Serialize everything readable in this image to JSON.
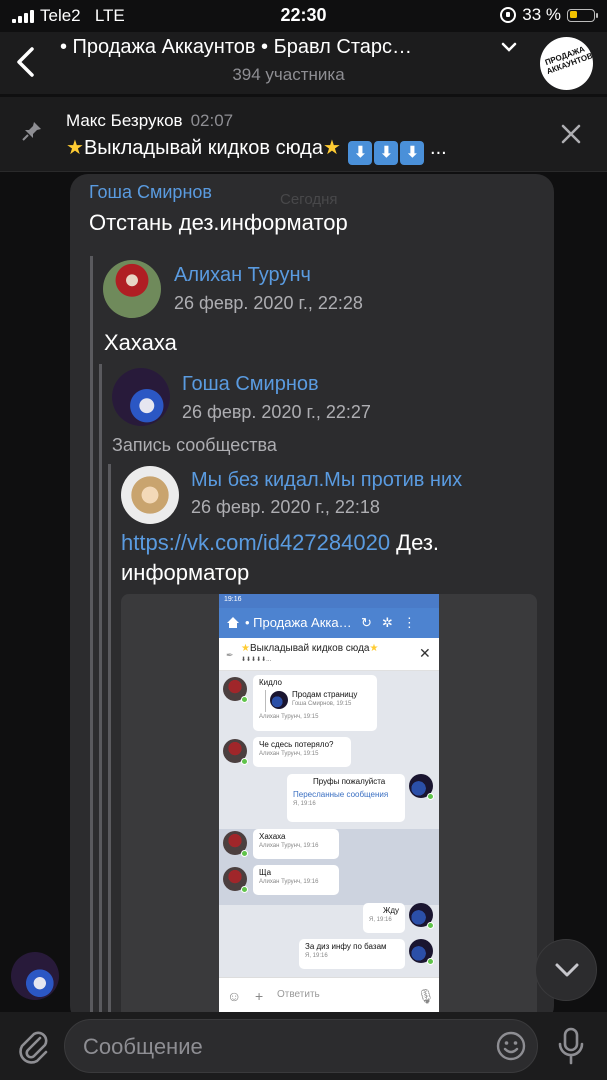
{
  "status_bar": {
    "carrier": "Tele2",
    "network": "LTE",
    "time": "22:30",
    "battery": "33 %",
    "battery_level": 0.33
  },
  "header": {
    "title": "• Продажа Аккаунтов • Бравл Старс…",
    "subtitle": "394 участника",
    "back_icon": "chevron-left-icon",
    "avatar_text": "ПРОДАЖА АККАУНТОВ"
  },
  "pinned": {
    "author": "Макс Безруков",
    "time": "02:07",
    "text": "Выкладывай кидков сюда",
    "trail": "...",
    "pin_icon": "pin-icon",
    "close_icon": "close-icon"
  },
  "message": {
    "author": "Гоша Смирнов",
    "date_badge": "Сегодня",
    "text": "Отстань дез.информатор",
    "forward1": {
      "name": "Алихан Турунч",
      "date": "26 февр. 2020 г., 22:28",
      "text": "Хахаха"
    },
    "forward2": {
      "name": "Гоша Смирнов",
      "date": "26 февр. 2020 г., 22:27",
      "label": "Запись сообщества"
    },
    "forward3": {
      "name": "Мы без кидал.Мы против них",
      "date": "26 февр. 2020 г., 22:18",
      "link": "https://vk.com/id427284020",
      "text": " Дез. информатор"
    }
  },
  "screenshot": {
    "time": "19:16",
    "title": "• Продажа Акка…",
    "pinned_text": "Выкладывай кидков сюда",
    "pinned_sub": "⬇⬇⬇⬇⬇...",
    "messages": [
      {
        "text": "Кидло",
        "quote_text": "Продам страницу",
        "quote_meta": "Гоша Смирнов, 19:15",
        "meta": "Алихан Турунч, 19:15"
      },
      {
        "text": "Че сдесь потеряло?",
        "meta": "Алихан Турунч, 19:15"
      },
      {
        "text": "Пруфы пожалуйста",
        "link": "Пересланные сообщения",
        "meta": "Я, 19:16"
      },
      {
        "text": "Хахаха",
        "meta": "Алихан Турунч, 19:16"
      },
      {
        "text": "Ща",
        "meta": "Алихан Турунч, 19:16"
      },
      {
        "text": "Жду",
        "meta": "Я, 19:16"
      },
      {
        "text": "За диз инфу по базам",
        "meta": "Я, 19:16"
      }
    ],
    "input_placeholder": "Ответить"
  },
  "composer": {
    "placeholder": "Сообщение"
  },
  "colors": {
    "accent": "#5a9be0",
    "background": "#0f0f10",
    "bubble": "#2c2c2e",
    "header": "#1c1c1d"
  }
}
